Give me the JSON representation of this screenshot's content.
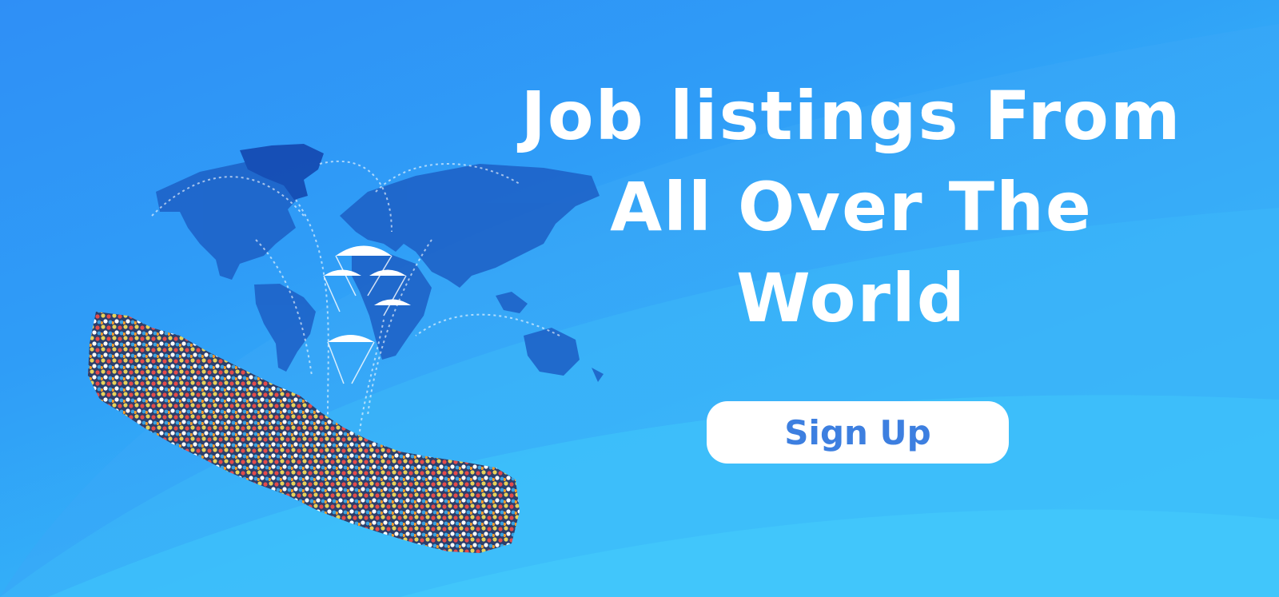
{
  "banner": {
    "headline_lines": [
      "Job listings From",
      "All Over The",
      "World"
    ],
    "cta_label": "Sign Up"
  },
  "colors": {
    "background_top": "#2f8ff6",
    "background_bottom": "#3ac6f9",
    "map_fill": "#1e63c8",
    "map_dark": "#1448b0",
    "headline": "#ffffff",
    "cta_background": "#ffffff",
    "cta_text": "#3d7fe0"
  },
  "icons": {
    "world_map": "world-map-icon",
    "nepal_crowd": "nepal-crowd-map-icon",
    "money_parachutes": "parachute-money-icon",
    "flight_paths": "flight-path-arrows-icon"
  }
}
